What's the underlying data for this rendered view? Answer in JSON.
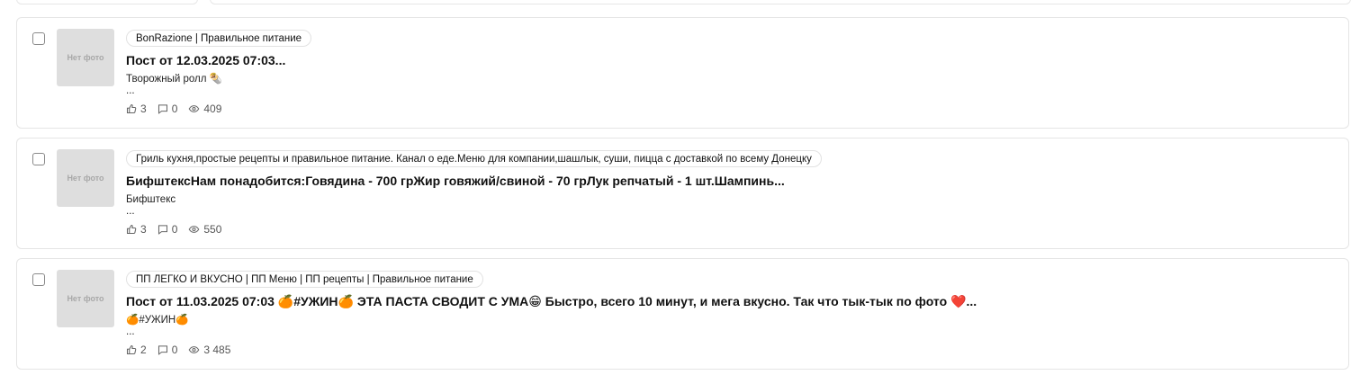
{
  "posts": [
    {
      "channel": "BonRazione | Правильное питание",
      "title": "Пост от 12.03.2025 07:03...",
      "snippet": "Творожный ролл 🌯",
      "ellipsis": "...",
      "thumb_text": "Нет фото",
      "likes": "3",
      "comments": "0",
      "views": "409"
    },
    {
      "channel": "Гриль кухня,простые рецепты и правильное питание. Канал о еде.Меню для компании,шашлык, суши, пицца с доставкой по всему Донецку",
      "title": "БифштексНам понадобится:Говядина - 700 грЖир говяжий/свиной - 70 грЛук репчатый - 1 шт.Шампинь...",
      "snippet": "Бифштекс",
      "ellipsis": "...",
      "thumb_text": "Нет фото",
      "likes": "3",
      "comments": "0",
      "views": "550"
    },
    {
      "channel": "ПП ЛЕГКО И ВКУСНО | ПП Меню | ПП рецепты | Правильное питание",
      "title": "Пост от 11.03.2025 07:03 🍊#УЖИН🍊 ЭТА ПАСТА СВОДИТ С УМА😁 Быстро, всего 10 минут, и мега вкусно. Так что тык-тык по фото ❤️...",
      "snippet": "🍊#УЖИН🍊",
      "ellipsis": "...",
      "thumb_text": "Нет фото",
      "likes": "2",
      "comments": "0",
      "views": "3 485"
    }
  ],
  "icons": {
    "like": "thumbs-up-icon",
    "comment": "comment-icon",
    "view": "eye-icon"
  }
}
